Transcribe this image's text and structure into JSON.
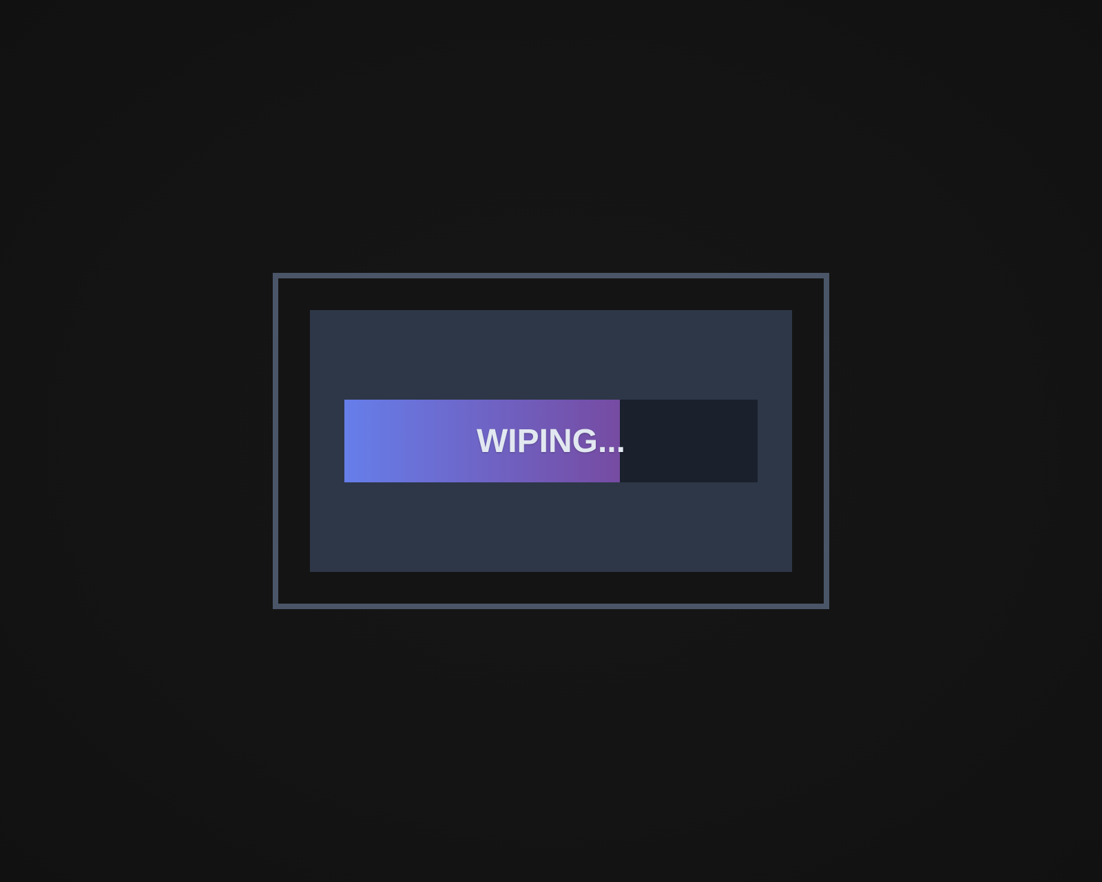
{
  "wipe_dialog": {
    "status_text": "WIPING...",
    "progress_fraction": 0.667
  },
  "colors": {
    "page_background": "#141414",
    "frame_border": "#4a5568",
    "panel_background": "#2e3748",
    "track_background": "#1a202c",
    "fill_gradient_start": "#667eea",
    "fill_gradient_end": "#764ba2",
    "label_text": "#e2e8f0"
  }
}
